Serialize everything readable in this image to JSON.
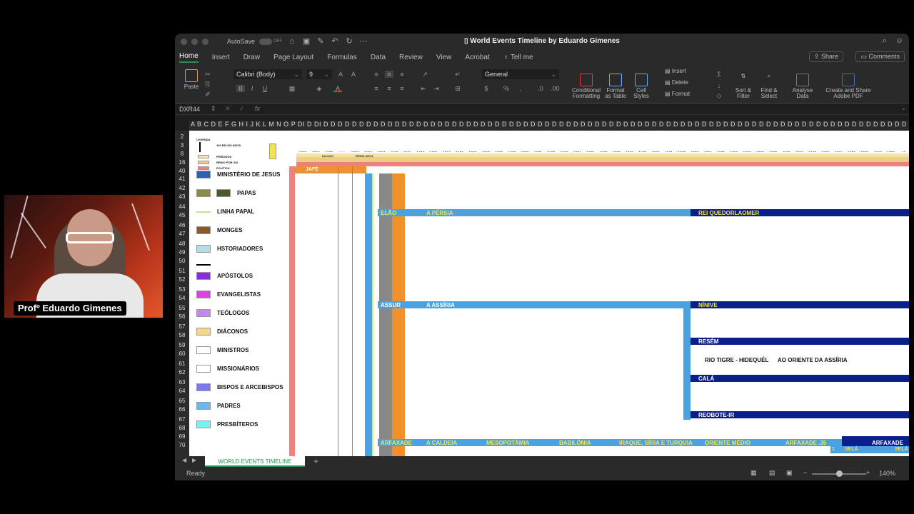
{
  "presenter": {
    "name": "Profº Eduardo Gimenes"
  },
  "window": {
    "title": "World Events Timeline by Eduardo Gimenes",
    "autosave_label": "AutoSave",
    "autosave_state": "OFF"
  },
  "menu": {
    "items": [
      "Home",
      "Insert",
      "Draw",
      "Page Layout",
      "Formulas",
      "Data",
      "Review",
      "View",
      "Acrobat",
      "Tell me"
    ],
    "share": "Share",
    "comments": "Comments"
  },
  "ribbon": {
    "paste": "Paste",
    "font_name": "Calibri (Body)",
    "font_size": "9",
    "number_format": "General",
    "conditional_formatting": "Conditional\nFormatting",
    "format_as_table": "Format\nas Table",
    "cell_styles": "Cell\nStyles",
    "insert": "Insert",
    "delete": "Delete",
    "format": "Format",
    "sort_filter": "Sort &\nFilter",
    "find_select": "Find &\nSelect",
    "analyse_data": "Analyse\nData",
    "create_share_pdf": "Create and Share\nAdobe PDF"
  },
  "formula_bar": {
    "name_box": "DXR44",
    "fx": "fx",
    "content": ""
  },
  "column_header_text": "A B C D E F G H I J K L M N O P  DI D DI D D D D D D D D D D D D D D D D D D D D D D D D D D D D D D D D D D D D D D D D D D D D D D D D D D D D D D D D D D D D D D D D D D D D D D D D D D D D D D D D D D D D D D DE DE DE DE DE DE DE DE",
  "rows": [
    "2",
    "3",
    "8",
    "16",
    "40",
    "41",
    "42",
    "43",
    "44",
    "45",
    "46",
    "47",
    "48",
    "49",
    "50",
    "51",
    "52",
    "53",
    "54",
    "55",
    "56",
    "57",
    "58",
    "59",
    "60",
    "61",
    "62",
    "63",
    "64",
    "65",
    "66",
    "67",
    "68",
    "69",
    "70"
  ],
  "legend_header": {
    "title": "LEGENDA",
    "scale": "100 EM 100 ANOS",
    "periods": "PERÍODOS",
    "reign": "REINO POR VIA",
    "politics": "POLÍTICA"
  },
  "years": [
    "1653",
    "1654",
    "1655",
    "1656",
    "1657",
    "1658",
    "1659",
    "1660",
    "1661",
    "1662",
    "1663",
    "1664",
    "1665",
    "1666",
    "1667",
    "1668",
    "1669",
    "1670",
    "1671",
    "1672",
    "1673",
    "1674",
    "1675",
    "1676",
    "1677",
    "1678",
    "1679",
    "1680",
    "1681",
    "1682",
    "1683",
    "1684",
    "1685",
    "1686",
    "1687",
    "1688",
    "1689",
    "1690",
    "1691",
    "1692",
    "1693",
    "1694",
    "1695",
    "1696",
    "1697",
    "1698",
    "16"
  ],
  "timeline_notes": {
    "flood": "DILÚVIO",
    "dry_land": "TERRA SECA",
    "japheth": "JAFÉ"
  },
  "legend": [
    {
      "label": "MINISTÉRIO DE JESUS",
      "color": "#2e5fb0"
    },
    {
      "label": "PAPAS",
      "color": "#8a8a4a",
      "color2": "#4a5a2a"
    },
    {
      "label": "LINHA PAPAL",
      "color": "#b8e986",
      "line": true
    },
    {
      "label": "MONGES",
      "color": "#8a5a2a"
    },
    {
      "label": "HSTORIADORES",
      "color": "#b7dce8"
    },
    {
      "label": "",
      "color": "#000000",
      "line": true
    },
    {
      "label": "APÓSTOLOS",
      "color": "#8a2be2"
    },
    {
      "label": "EVANGELISTAS",
      "color": "#e040e0"
    },
    {
      "label": "TEÓLOGOS",
      "color": "#c08ae8"
    },
    {
      "label": "DIÁCONOS",
      "color": "#f5d78a"
    },
    {
      "label": "MINISTROS",
      "color": "#ffffff"
    },
    {
      "label": "MISSIONÁRIOS",
      "color": "#ffffff"
    },
    {
      "label": "BISPOS E ARCEBISPOS",
      "color": "#7a7ae8"
    },
    {
      "label": "PADRES",
      "color": "#6ab8f0"
    },
    {
      "label": "PRESBÍTEROS",
      "color": "#7af0f0"
    }
  ],
  "blocks": {
    "elao": "ELÃO",
    "persia": "A PÉRSIA",
    "quedorlaomer": "REI QUEDORLAOMER",
    "assur": "ASSUR",
    "assiria": "A ASSÍRIA",
    "ninive": "NÍNIVE",
    "resem": "RESÉM",
    "tigre": "RIO TIGRE - HIDEQUÉL",
    "oriente_assiria": "AO ORIENTE DA ASSÍRIA",
    "cala": "CALÁ",
    "reboteir": "REOBOTE-IR",
    "arfaxade": "ARFAXADE",
    "caldeia": "A CALDEIA",
    "mesopotamia": "MESOPOTÂMIA",
    "babilonia": "BABILÔNIA",
    "iraque": "IRAQUE, SÍRIA E TURQUIA",
    "oriente_medio": "ORIENTE MÉDIO",
    "arfaxade35": "ARFAXADE  .35",
    "arfaxade2": "ARFAXADE",
    "sela": "SELÁ",
    "sela2": "SELÁ",
    "one": "1"
  },
  "sheet_tab": "WORLD EVENTS TIMELINE",
  "status": {
    "ready": "Ready",
    "zoom": "140%"
  },
  "colors": {
    "accent": "#2e8b57",
    "blue_light": "#4aa3e0",
    "navy": "#0a1f8a",
    "orange": "#f0922b",
    "salmon": "#f08080",
    "yellow": "#f5e3a0"
  }
}
